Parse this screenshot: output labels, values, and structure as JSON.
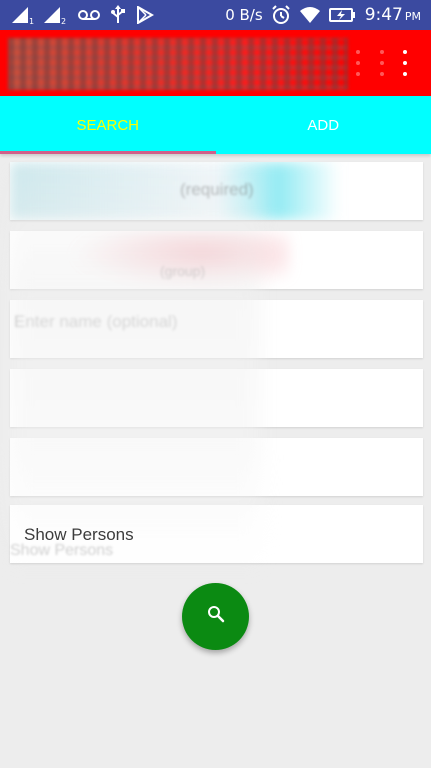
{
  "status_bar": {
    "network_speed": "0 B/s",
    "time": "9:47",
    "time_suffix": "PM",
    "icons": [
      "signal-1-icon",
      "signal-2-icon",
      "voicemail-icon",
      "usb-icon",
      "play-store-icon",
      "alarm-icon",
      "wifi-icon",
      "battery-charging-icon"
    ],
    "signal_labels": [
      "1",
      "2"
    ]
  },
  "toolbar": {
    "title": "",
    "actions": [
      "more-options-icon",
      "more-options-icon"
    ]
  },
  "tabs": [
    {
      "label": "SEARCH",
      "selected": true
    },
    {
      "label": "ADD",
      "selected": false
    }
  ],
  "cards": [
    {
      "label": "(required)"
    },
    {
      "label": "(group)"
    },
    {
      "label": "Enter name (optional)"
    },
    {
      "label": ""
    },
    {
      "label": ""
    },
    {
      "label": "Show Persons"
    }
  ],
  "fab": {
    "icon": "search-icon"
  },
  "colors": {
    "status_bar": "#3b4aa0",
    "toolbar": "#ff0000",
    "tabs": "#00ffff",
    "tab_selected_text": "#ffff00",
    "tab_text": "#ffffff",
    "tab_indicator": "#d0608a",
    "fab": "#0b8a12",
    "background": "#ededed"
  }
}
